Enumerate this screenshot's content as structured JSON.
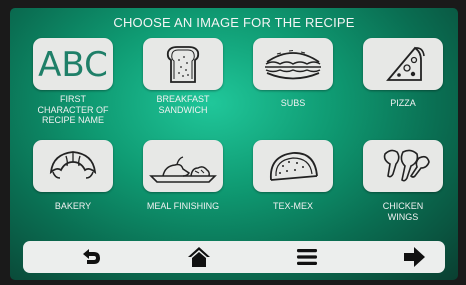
{
  "header": {
    "title": "CHOOSE AN IMAGE FOR THE RECIPE"
  },
  "tiles": [
    {
      "label_lines": [
        "FIRST",
        "CHARACTER OF",
        "RECIPE NAME"
      ],
      "icon": "abc-text-icon",
      "icon_text": "ABC"
    },
    {
      "label_lines": [
        "BREAKFAST",
        "SANDWICH"
      ],
      "icon": "toast-icon"
    },
    {
      "label_lines": [
        "SUBS"
      ],
      "icon": "sub-sandwich-icon"
    },
    {
      "label_lines": [
        "PIZZA"
      ],
      "icon": "pizza-slice-icon"
    },
    {
      "label_lines": [
        "BAKERY"
      ],
      "icon": "croissant-icon"
    },
    {
      "label_lines": [
        "MEAL FINISHING"
      ],
      "icon": "meal-plate-icon"
    },
    {
      "label_lines": [
        "TEX-MEX"
      ],
      "icon": "taco-icon"
    },
    {
      "label_lines": [
        "CHICKEN",
        "WINGS"
      ],
      "icon": "chicken-wings-icon"
    }
  ],
  "navbar": {
    "buttons": [
      "back-icon",
      "home-icon",
      "menu-icon",
      "next-arrow-icon"
    ]
  },
  "colors": {
    "accent": "#1f7f68",
    "background_green": "#0f9a72",
    "tile": "#e7e8e6"
  }
}
